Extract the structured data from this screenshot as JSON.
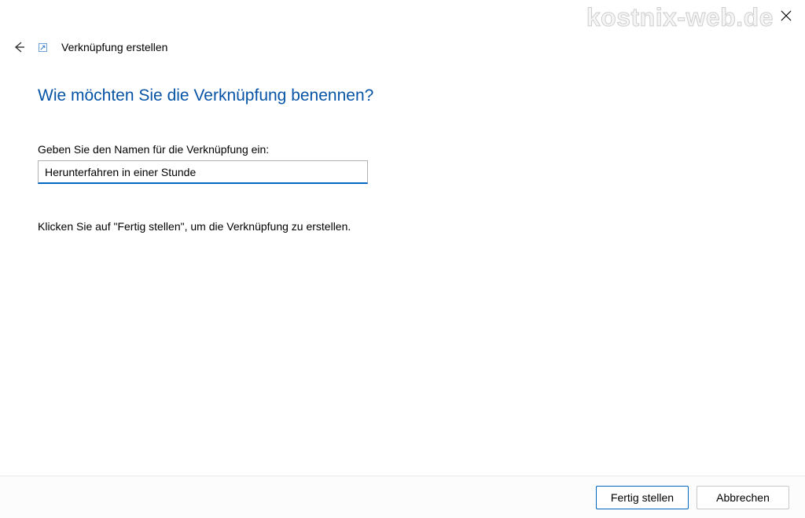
{
  "watermark": "kostnix-web.de",
  "header": {
    "title": "Verknüpfung erstellen"
  },
  "main": {
    "question": "Wie möchten Sie die Verknüpfung benennen?",
    "field_label": "Geben Sie den Namen für die Verknüpfung ein:",
    "name_value": "Herunterfahren in einer Stunde",
    "instruction": "Klicken Sie auf \"Fertig stellen\", um die Verknüpfung zu erstellen."
  },
  "footer": {
    "finish_label": "Fertig stellen",
    "cancel_label": "Abbrechen"
  }
}
